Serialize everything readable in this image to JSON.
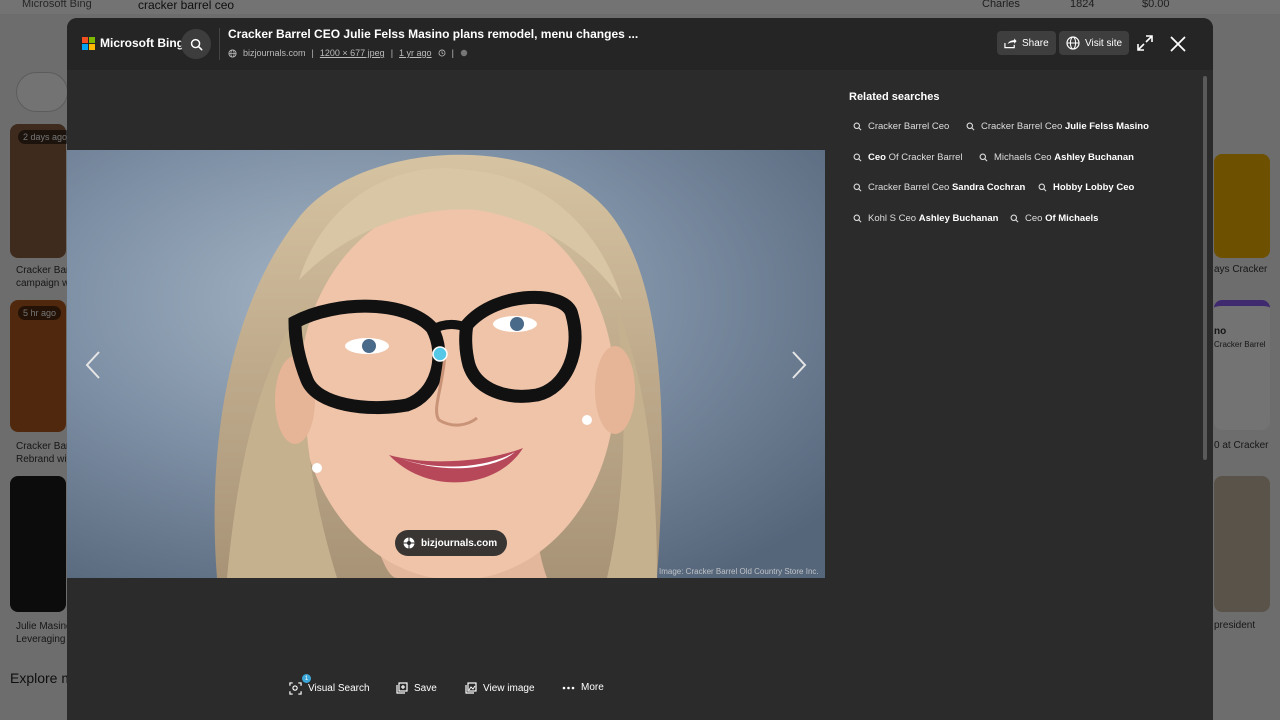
{
  "background": {
    "brand": "Microsoft Bing",
    "query": "cracker barrel ceo",
    "user": "Charles",
    "points": "1824",
    "cash": "$0.00",
    "badges": [
      "2 days ago",
      "5 hr ago"
    ],
    "captions": [
      "Cracker Barr\ncampaign w",
      "Cracker Barr\nRebrand wit",
      "Julie Masino\nLeveraging"
    ],
    "right_captions": [
      "ays Cracker",
      "no",
      "Cracker Barrel",
      "0 at Cracker",
      "president"
    ],
    "explore": "Explore m"
  },
  "header": {
    "brand": "Microsoft Bing",
    "title": "Cracker Barrel CEO Julie Felss Masino plans remodel, menu changes ...",
    "source": "bizjournals.com",
    "dimensions": "1200 × 677 jpeg",
    "age": "1 yr ago",
    "share_label": "Share",
    "visit_label": "Visit site"
  },
  "image": {
    "source_label": "bizjournals.com",
    "credit": "Image: Cracker Barrel Old Country Store Inc."
  },
  "related": {
    "title": "Related searches",
    "items": [
      {
        "plain": "Cracker Barrel Ceo",
        "bold": ""
      },
      {
        "plain": "Cracker Barrel Ceo ",
        "bold": "Julie Felss Masino"
      },
      {
        "plain": "Of Cracker Barrel",
        "bold": "Ceo "
      },
      {
        "plain": "Michaels Ceo ",
        "bold": "Ashley Buchanan"
      },
      {
        "plain": "Cracker Barrel Ceo ",
        "bold": "Sandra Cochran"
      },
      {
        "plain": "",
        "bold": "Hobby Lobby Ceo"
      },
      {
        "plain": "Kohl S Ceo ",
        "bold": "Ashley Buchanan"
      },
      {
        "plain": "Ceo ",
        "bold": "Of Michaels"
      }
    ]
  },
  "actions": {
    "visual_search": "Visual Search",
    "visual_search_badge": "1",
    "save": "Save",
    "view_image": "View image",
    "more": "More"
  },
  "colors": {
    "modal_bg": "#2b2b2b",
    "header_bg": "#252525",
    "accent": "#3ba6d8"
  }
}
